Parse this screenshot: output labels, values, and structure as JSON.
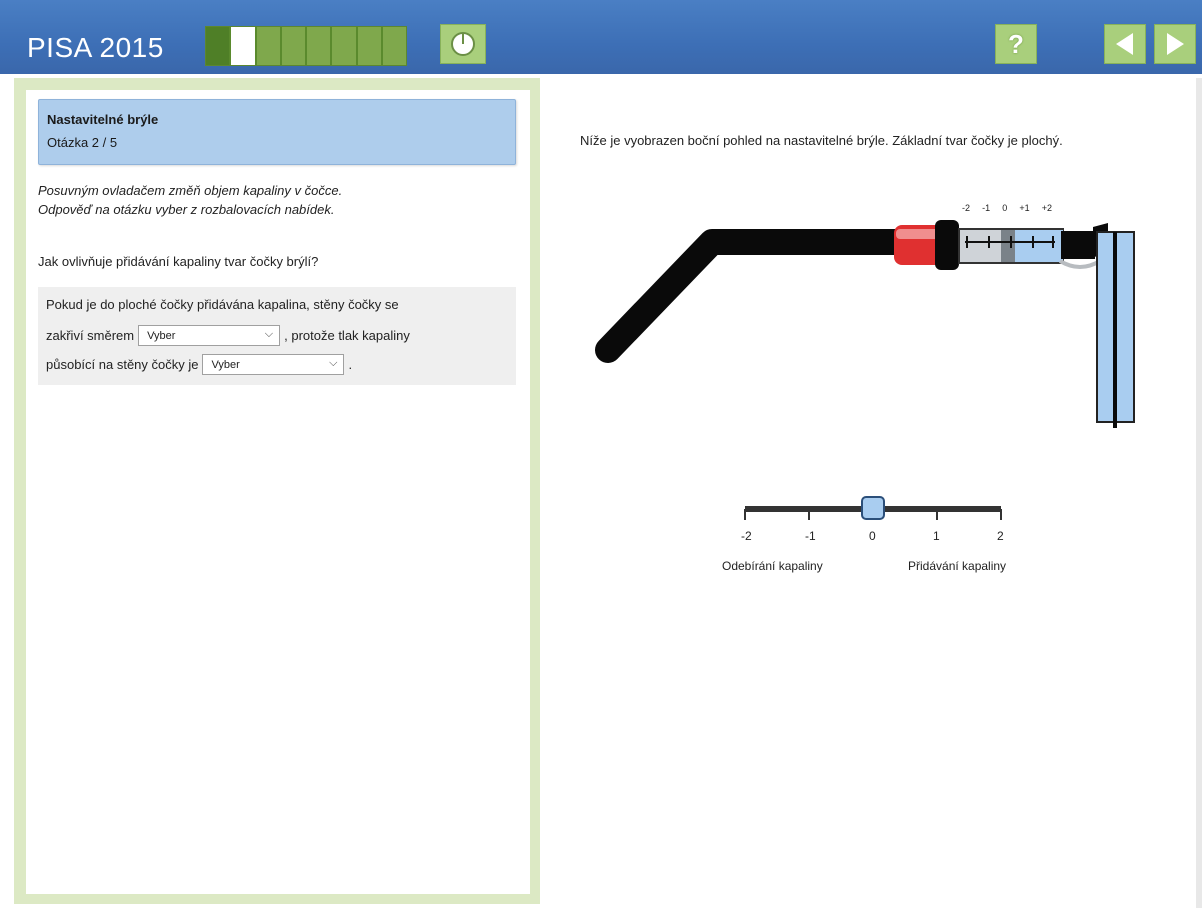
{
  "header": {
    "title": "PISA 2015",
    "progress": {
      "total_segments": 8,
      "current_segment": 2
    },
    "help_label": "?"
  },
  "question": {
    "title": "Nastavitelné brýle",
    "number": "Otázka 2 / 5",
    "instruction_line1": "Posuvným ovladačem změň objem kapaliny v čočce.",
    "instruction_line2": "Odpověď na otázku vyber z rozbalovacích nabídek.",
    "prompt": "Jak ovlivňuje přidávání kapaliny tvar čočky brýlí?"
  },
  "answer": {
    "line1": "Pokud je do ploché čočky přidávána kapalina, stěny čočky se",
    "line2_before": "zakřiví směrem",
    "select1": "Vyber",
    "line2_after": ", protože tlak kapaliny",
    "line3_before": "působící na stěny čočky je",
    "select2": "Vyber",
    "line3_after": "."
  },
  "stimulus": {
    "description": "Níže je vyobrazen boční pohled na nastavitelné brýle. Základní tvar čočky je plochý.",
    "mini_scale_labels": [
      "-2",
      "-1",
      "0",
      "+1",
      "+2"
    ]
  },
  "slider": {
    "value": 0,
    "min": -2,
    "max": 2,
    "tick_labels": [
      "-2",
      "-1",
      "0",
      "1",
      "2"
    ],
    "left_caption": "Odebírání kapaliny",
    "right_caption": "Přidávání kapaliny"
  },
  "colors": {
    "topbar": "#3d6fb6",
    "progress_green": "#7fa84c",
    "button_green": "#a9cf7c",
    "header_blue": "#aecdec",
    "lens_blue": "#a9cdf0",
    "clip_red": "#e03030"
  }
}
